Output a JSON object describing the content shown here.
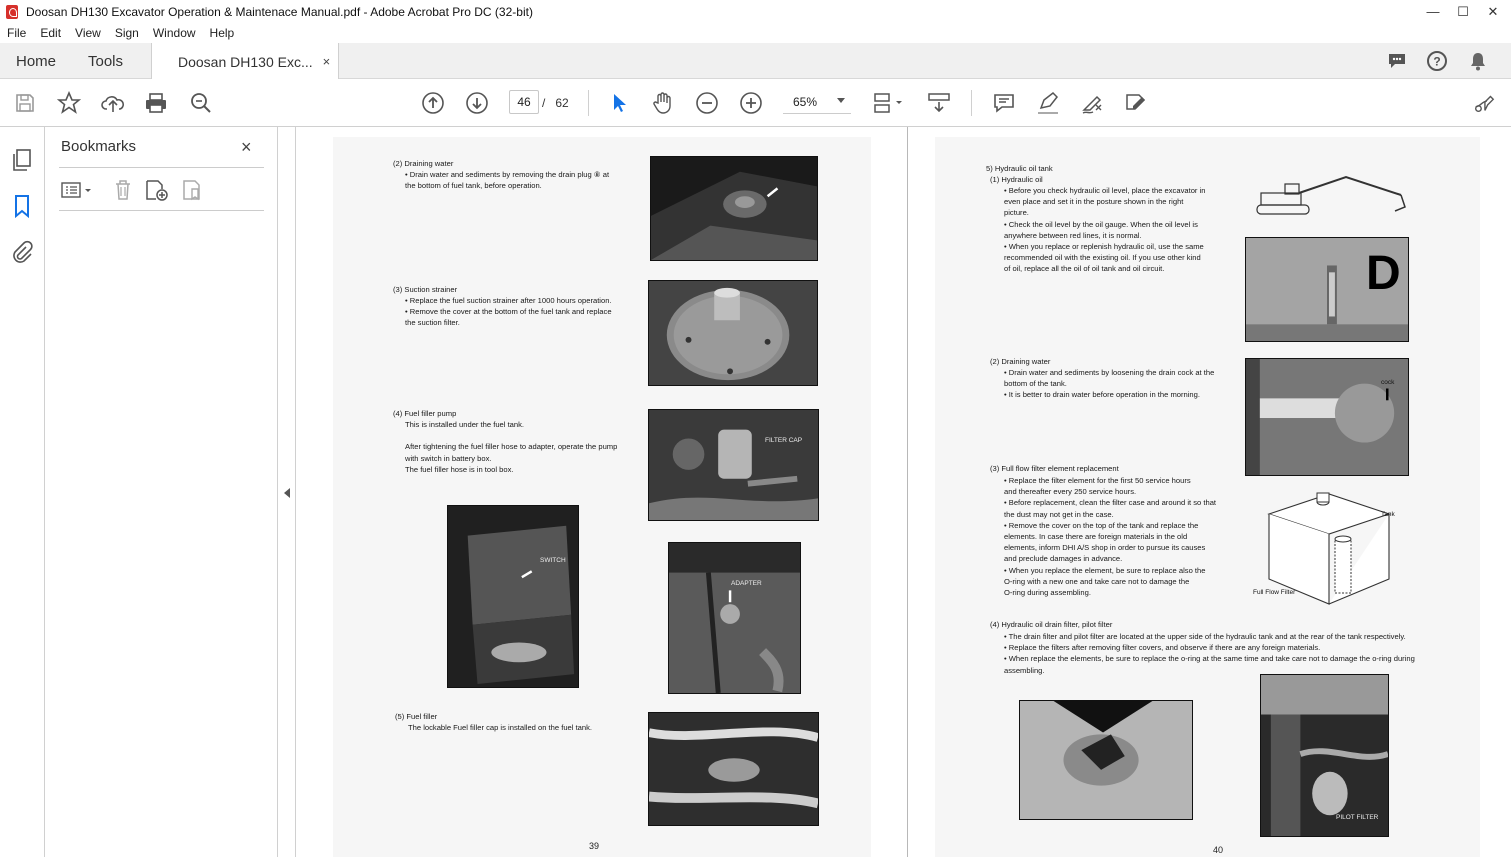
{
  "window": {
    "title": "Doosan DH130 Excavator Operation & Maintenace Manual.pdf - Adobe Acrobat Pro DC (32-bit)"
  },
  "menu": [
    "File",
    "Edit",
    "View",
    "Sign",
    "Window",
    "Help"
  ],
  "tabs": {
    "home": "Home",
    "tools": "Tools",
    "doc": "Doosan DH130 Exc...",
    "close": "×"
  },
  "toolbar": {
    "page_current": "46",
    "page_sep": "/",
    "page_total": "62",
    "zoom": "65%"
  },
  "bookmarks": {
    "title": "Bookmarks",
    "close": "×"
  },
  "left_page": {
    "s2_title": "(2) Draining water",
    "s2_body": "• Drain water and sediments by removing the drain plug ⑧ at\n   the bottom of fuel tank, before operation.",
    "s3_title": "(3) Suction strainer",
    "s3_body": "• Replace the fuel suction strainer after 1000 hours operation.\n• Remove the cover at the bottom of the fuel tank and replace\n   the suction filter.",
    "s4_title": "(4) Fuel filler pump",
    "s4_body": "This is installed under the fuel tank.\n\nAfter tightening the fuel filler hose to adapter, operate the pump\nwith switch in battery box.\nThe fuel filler hose is in tool box.",
    "s5_title": "(5) Fuel filler",
    "s5_body": "The lockable Fuel filler cap is installed on the fuel tank.",
    "label_filter_cap": "FILTER CAP",
    "label_switch": "SWITCH",
    "label_adapter": "ADAPTER",
    "page_number": "39"
  },
  "right_page": {
    "s5_title": "5)  Hydraulic oil tank",
    "s1_title": "(1)  Hydraulic oil",
    "s1_body": "• Before you check hydraulic oil level, place the excavator in\n   even place and set it in the posture shown in the right\n   picture.\n• Check the oil level by the oil gauge. When the oil level is\n   anywhere between red lines, it is normal.\n• When you replace or replenish hydraulic oil, use the same\n   recommended oil with the existing oil. If you use other kind\n   of oil, replace all the oil of oil tank and oil circuit.",
    "s2_title": "(2)  Draining water",
    "s2_body": "• Drain water and sediments by loosening the drain cock at the\n   bottom of the tank.\n• It is better to drain water before operation in the morning.",
    "s3_title": "(3)  Full flow filter element replacement",
    "s3_body": "• Replace the filter element for the first 50 service hours\n   and thereafter every 250 service hours.\n• Before replacement, clean the filter case and around it so that\n   the dust may not get in the case.\n• Remove the cover on the top of the tank and replace the\n   elements. In case there are foreign materials in the old\n   elements, inform DHI A/S shop in order to pursue its causes\n   and preclude damages in advance.\n• When you replace the element, be sure to replace also the\n   O-ring with a new one and take care not to damage the\n   O-ring during assembling.",
    "s4_title": "(4)  Hydraulic oil drain filter, pilot filter",
    "s4_body": "• The drain filter and pilot filter are located at the upper side of the hydraulic tank and at the rear of the tank respectively.\n• Replace the filters after removing filter covers, and observe if there are any foreign materials.\n• When replace the elements, be sure to replace the o-ring at the same time and take care not to damage the o-ring during\n   assembling.",
    "label_gauge": "D",
    "label_cock": "cock",
    "label_tank": "Tank",
    "label_full_flow": "Full Flow Filter",
    "label_pilot": "PILOT FILTER",
    "page_number": "40"
  },
  "colors": {
    "accent": "#1473e6",
    "pdf_red": "#d6302b"
  }
}
